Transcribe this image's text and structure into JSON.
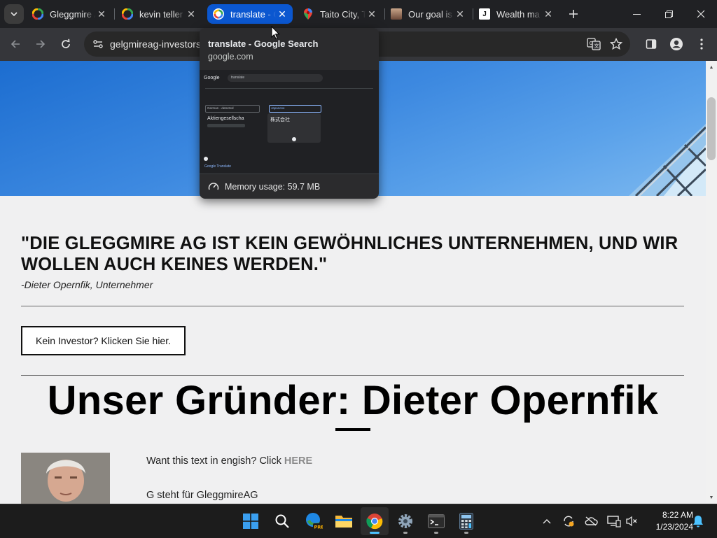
{
  "browser": {
    "tabs": [
      {
        "title": "Gleggmire AG",
        "favicon": "google-icon",
        "active": false
      },
      {
        "title": "kevin teller",
        "favicon": "google-icon",
        "active": false
      },
      {
        "title": "translate - Google Search",
        "favicon": "google-icon",
        "active": true
      },
      {
        "title": "Taito City, Tokyo",
        "favicon": "maps-pin-icon",
        "active": false
      },
      {
        "title": "Our goal is",
        "favicon": "portrait-icon",
        "active": false
      },
      {
        "title": "Wealth ma",
        "favicon": "j-icon",
        "active": false
      }
    ],
    "address_bar": {
      "url": "gelgmireag-investors"
    },
    "hover_card": {
      "title": "translate - Google Search",
      "domain": "google.com",
      "memory": "Memory usage: 59.7 MB",
      "preview": {
        "search_query": "translate",
        "source_lang": "German - detected",
        "target_lang": "Japanese",
        "source_text": "Aktiengesellscha",
        "target_text": "株式会社",
        "footer": "Google Translate"
      }
    }
  },
  "page": {
    "quote": "\"DIE GLEGGMIRE AG IST KEIN GEWÖHNLICHES UNTERNEHMEN, UND WIR WOLLEN AUCH KEINES WERDEN.\"",
    "quote_author": "-Dieter Opernfik, Unternehmer",
    "investor_button": "Kein Investor? Klicken Sie hier.",
    "founder_title": "Unser Gründer: Dieter Opernfik",
    "intro_prefix": "Want this text in engish? Click ",
    "intro_link": "HERE",
    "body_line": "G steht für GleggmireAG"
  },
  "taskbar": {
    "time": "8:22 AM",
    "date": "1/23/2024"
  },
  "colors": {
    "active_tab": "#0b57d0",
    "hero_sky": "#3d89e0",
    "taskbar_indicator": "#4cc2ff"
  }
}
